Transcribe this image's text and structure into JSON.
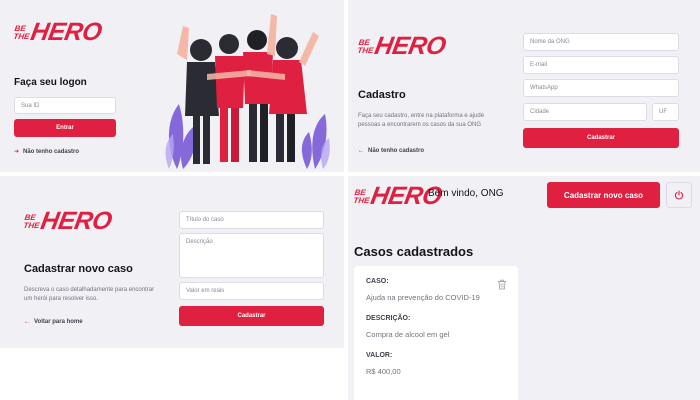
{
  "brand": {
    "line1": "BE",
    "line2": "THE",
    "main": "HERO",
    "accent": "#e02041"
  },
  "logon": {
    "title": "Faça seu logon",
    "id_placeholder": "Sua ID",
    "button": "Entrar",
    "register_link": "Não tenho cadastro"
  },
  "register": {
    "title": "Cadastro",
    "description": "Faça seu cadastro, entre na plataforma e ajude pessoas a encontrarem os casos da sua ONG",
    "back_link": "Não tenho cadastro",
    "name_placeholder": "Nome da ONG",
    "email_placeholder": "E-mail",
    "whatsapp_placeholder": "WhatsApp",
    "city_placeholder": "Cidade",
    "uf_placeholder": "UF",
    "button": "Cadastrar"
  },
  "new_incident": {
    "title": "Cadastrar novo caso",
    "description": "Descreva o caso detalhadamente para encontrar um herói para resolver isso.",
    "back_link": "Voltar para home",
    "title_placeholder": "Título do caso",
    "description_placeholder": "Descrição",
    "value_placeholder": "Valor em reais",
    "button": "Cadastrar"
  },
  "profile": {
    "welcome": "Bem vindo, ONG",
    "new_case_button": "Cadastrar novo caso",
    "section_title": "Casos cadastrados",
    "power_icon": "power-icon",
    "cases": [
      {
        "case_label": "CASO:",
        "case_value": "Ajuda na prevenção do COVID-19",
        "desc_label": "DESCRIÇÃO:",
        "desc_value": "Compra de alcool em gel",
        "value_label": "VALOR:",
        "value_value": "R$ 400,00"
      }
    ]
  }
}
